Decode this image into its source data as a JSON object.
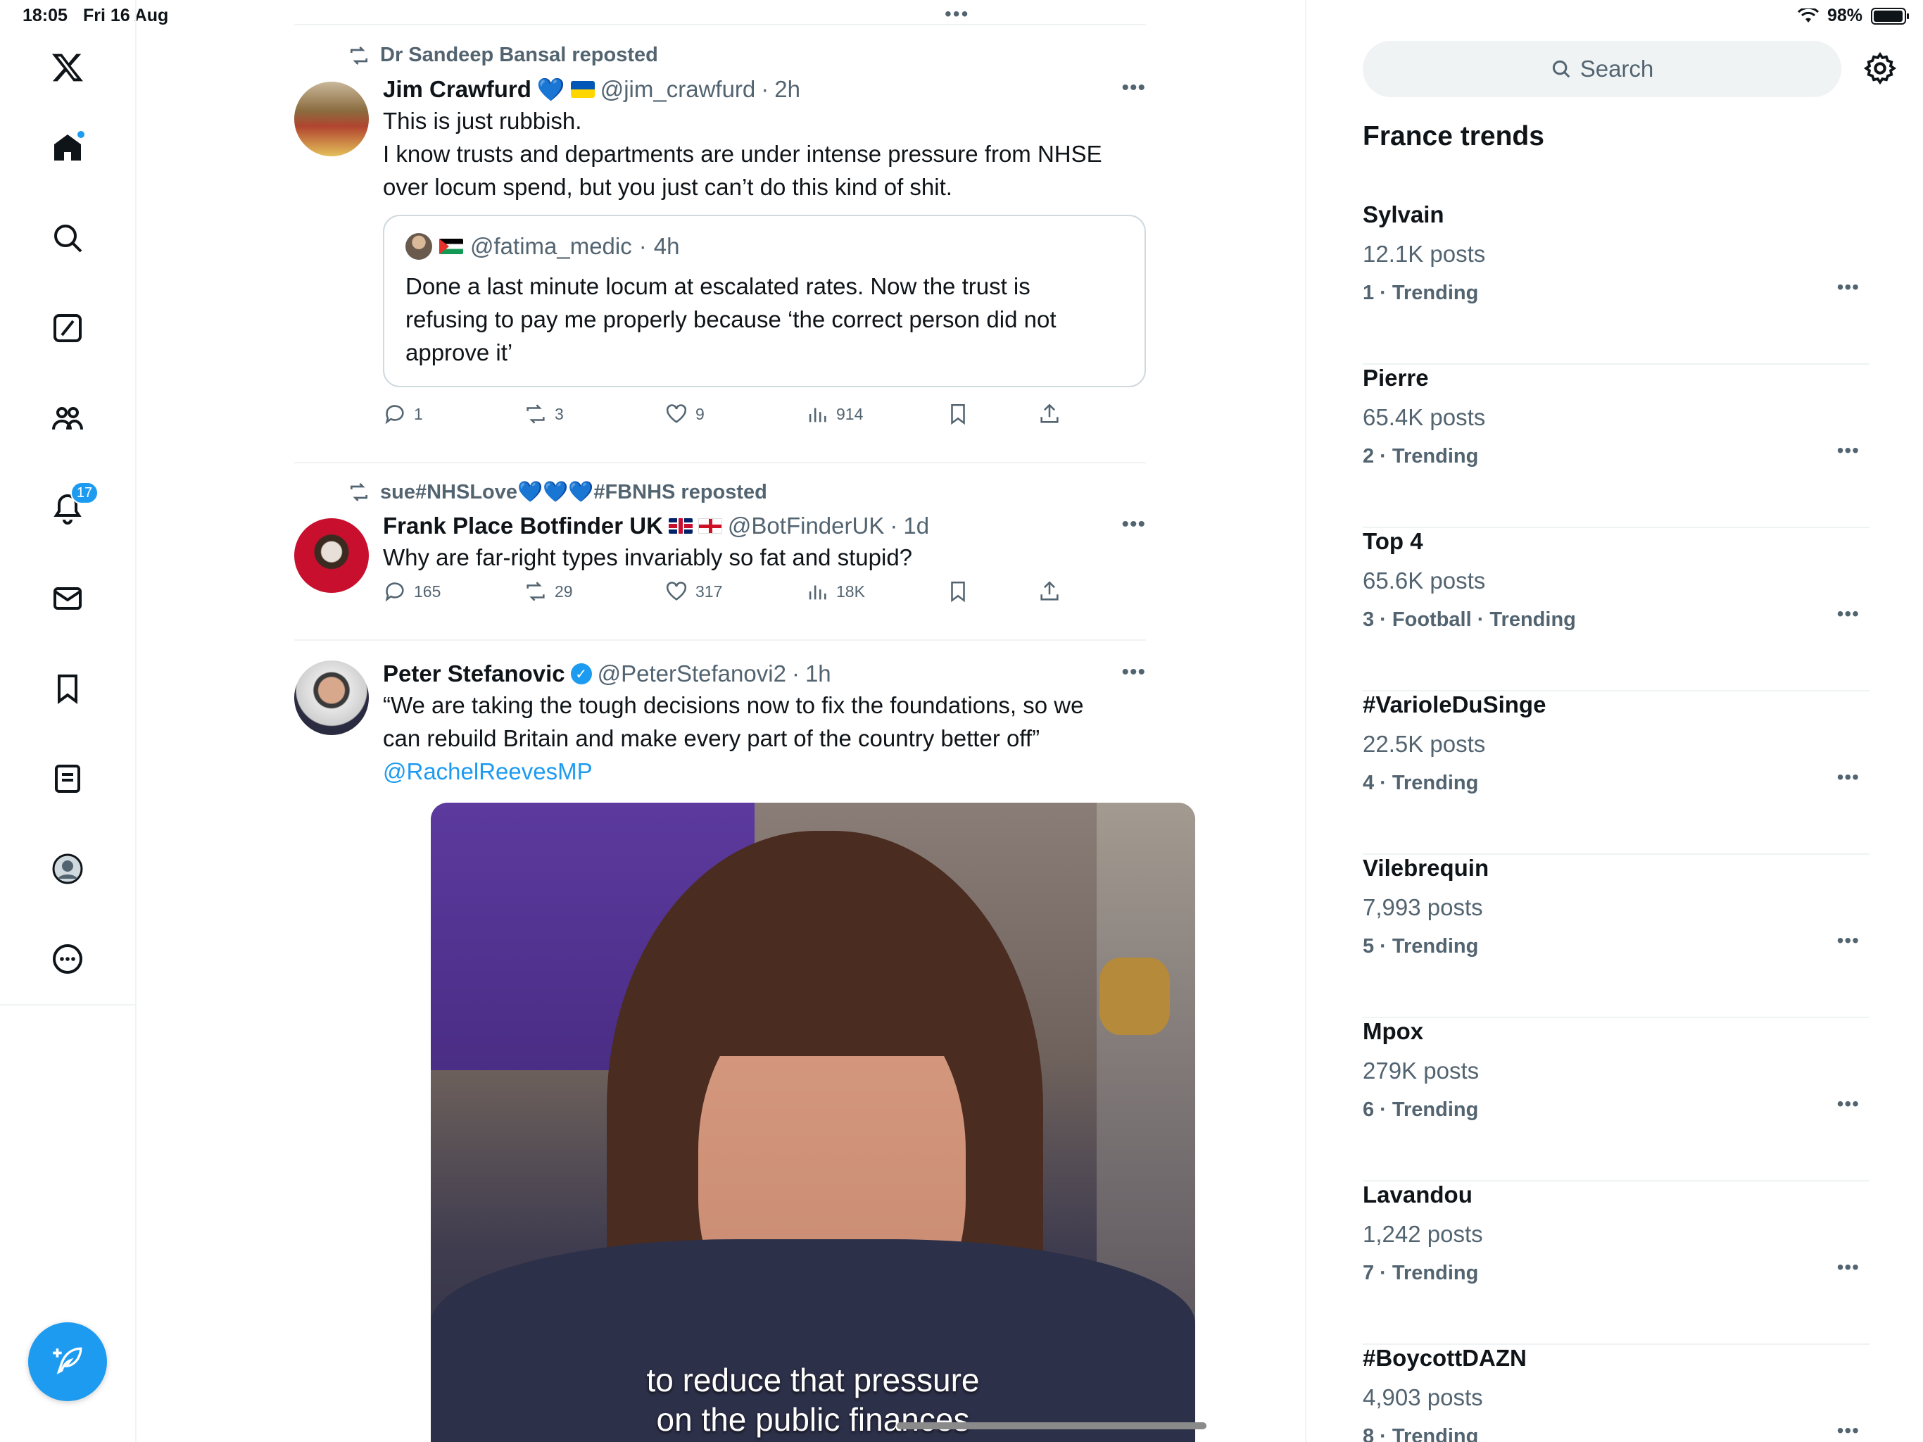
{
  "status": {
    "time": "18:05",
    "date": "Fri 16 Aug",
    "battery": "98%",
    "battery_level": 0.98
  },
  "nav": {
    "items": [
      {
        "name": "x-logo"
      },
      {
        "name": "home"
      },
      {
        "name": "explore"
      },
      {
        "name": "grok"
      },
      {
        "name": "communities"
      },
      {
        "name": "notifications"
      },
      {
        "name": "messages"
      },
      {
        "name": "bookmarks"
      },
      {
        "name": "lists"
      },
      {
        "name": "profile"
      },
      {
        "name": "more"
      }
    ],
    "notifications_badge": "17"
  },
  "feed": {
    "top_dots": "•••",
    "posts": [
      {
        "repost_by": "Dr Sandeep Bansal reposted",
        "author": "Jim Crawfurd",
        "handle": "@jim_crawfurd",
        "time": "2h",
        "text_lines": [
          "This is just rubbish.",
          "I know trusts and departments are under intense pressure from NHSE",
          "over locum spend, but you just can’t do this kind of shit."
        ],
        "quote": {
          "handle": "@fatima_medic",
          "time": "4h",
          "text_lines": [
            "Done a last minute locum at escalated rates. Now the trust is",
            "refusing to pay me properly because ‘the correct person did not",
            "approve it’"
          ]
        },
        "stats": {
          "replies": "1",
          "reposts": "3",
          "likes": "9",
          "views": "914"
        }
      },
      {
        "repost_by": "sue#NHSLove💙💙💙#FBNHS reposted",
        "author": "Frank Place Botfinder UK",
        "handle": "@BotFinderUK",
        "time": "1d",
        "text_lines": [
          "Why are far-right types invariably so fat and stupid?"
        ],
        "stats": {
          "replies": "165",
          "reposts": "29",
          "likes": "317",
          "views": "18K"
        }
      },
      {
        "author": "Peter Stefanovic",
        "handle": "@PeterStefanovi2",
        "time": "1h",
        "text_lines": [
          "“We are taking the tough decisions now to fix the foundations, so we",
          "can rebuild Britain and make every part of the country better off”"
        ],
        "mention": "@RachelReevesMP",
        "video_subtitles": [
          "to reduce that pressure",
          "on the public finances"
        ]
      }
    ],
    "dot_sep": "·"
  },
  "sidebar": {
    "search_placeholder": "Search",
    "trends_title": "France trends",
    "trends": [
      {
        "name": "Sylvain",
        "posts": "12.1K posts",
        "meta": "1 · Trending"
      },
      {
        "name": "Pierre",
        "posts": "65.4K posts",
        "meta": "2 · Trending"
      },
      {
        "name": "Top 4",
        "posts": "65.6K posts",
        "meta": "3 · Football · Trending"
      },
      {
        "name": "#VarioleDuSinge",
        "posts": "22.5K posts",
        "meta": "4 · Trending"
      },
      {
        "name": "Vilebrequin",
        "posts": "7,993 posts",
        "meta": "5 · Trending"
      },
      {
        "name": "Mpox",
        "posts": "279K posts",
        "meta": "6 · Trending"
      },
      {
        "name": "Lavandou",
        "posts": "1,242 posts",
        "meta": "7 · Trending"
      },
      {
        "name": "#BoycottDAZN",
        "posts": "4,903 posts",
        "meta": "8 · Trending"
      }
    ],
    "more_dots": "•••"
  },
  "colors": {
    "accent": "#1d9bf0",
    "muted": "#536471",
    "text": "#0f1419",
    "border": "#eff3f4"
  }
}
